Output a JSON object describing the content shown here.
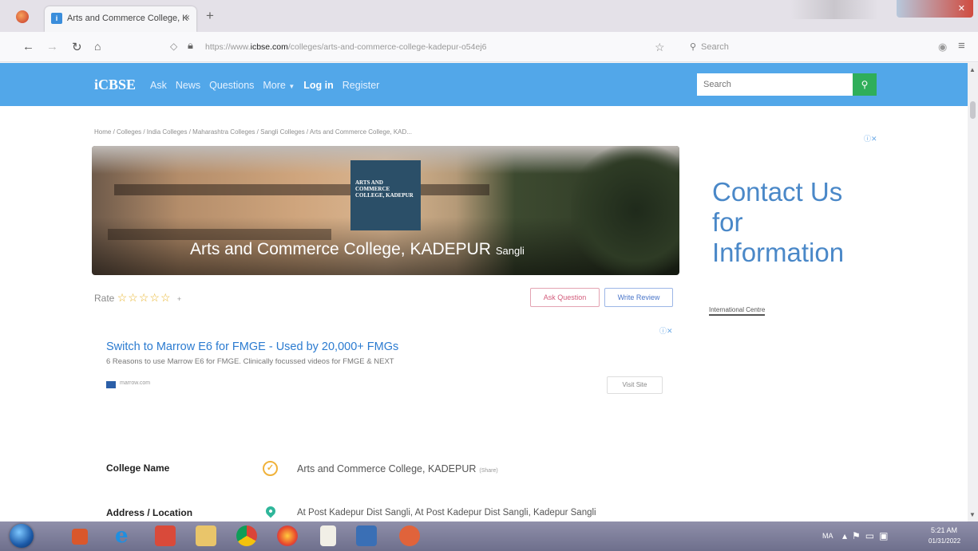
{
  "browser": {
    "tab_title": "Arts and Commerce College, K",
    "tab_favicon": "i",
    "tab_close": "×",
    "new_tab": "+",
    "url_prefix": "https://www.",
    "url_domain": "icbse.com",
    "url_path": "/colleges/arts-and-commerce-college-kadepur-o54ej6",
    "search_placeholder": "Search",
    "icons": [
      "back-arrow-icon",
      "forward-arrow-icon",
      "reload-icon",
      "home-icon",
      "shield-icon",
      "lock-icon",
      "star-icon",
      "search-icon",
      "pocket-icon",
      "menu-icon"
    ]
  },
  "site": {
    "logo": "iCBSE",
    "nav": {
      "ask": "Ask",
      "news": "News",
      "questions": "Questions",
      "more": "More",
      "login": "Log in",
      "register": "Register"
    },
    "search_placeholder": "Search",
    "search_icon": "search-icon",
    "colors": {
      "header": "#52a7e9",
      "search_button": "#2fae5a"
    }
  },
  "breadcrumb": "Home  /  Colleges  /  India Colleges  /  Maharashtra Colleges  /  Sangli Colleges  /  Arts and Commerce College, KAD...",
  "ad_marker": "ⓘ✕",
  "banner": {
    "logo_lines": [
      "ARTS AND",
      "COMMERCE",
      "COLLEGE, KADEPUR"
    ],
    "title": "Arts and Commerce College, KADEPUR",
    "city": "Sangli"
  },
  "rating": {
    "label": "Rate",
    "stars_total": 5,
    "count": "+"
  },
  "buttons": {
    "ask_question": "Ask Question",
    "write_review": "Write Review"
  },
  "side_ad": {
    "line1": "Contact Us",
    "line2": "for",
    "line3": "Information",
    "link": "International Centre"
  },
  "marrow_ad": {
    "headline": "Switch to Marrow E6 for FMGE - Used by 20,000+ FMGs",
    "description": "6 Reasons to use Marrow E6 for FMGE. Clinically focussed videos for FMGE & NEXT",
    "domain": "marrow.com",
    "button": "Visit Site"
  },
  "details": {
    "college_name_label": "College Name",
    "college_name_value": "Arts and Commerce College, KADEPUR",
    "share": "(Share)",
    "address_label": "Address / Location",
    "address_value": "At Post Kadepur Dist Sangli, At Post Kadepur Dist Sangli, Kadepur Sangli"
  },
  "taskbar": {
    "tray_lang": "MA",
    "time": "5:21 AM",
    "date": "01/31/2022"
  }
}
